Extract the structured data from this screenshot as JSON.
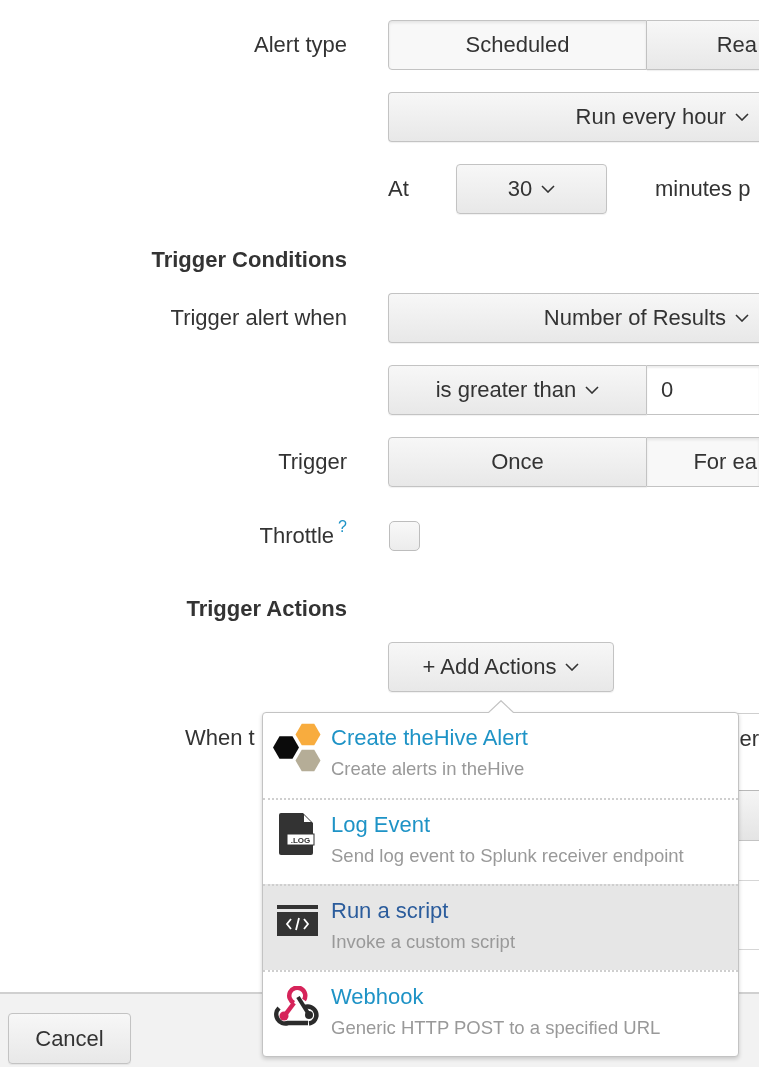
{
  "sections": [
    {
      "rows": [
        {
          "kind": "segmented",
          "label": "Alert type",
          "options": [
            {
              "label": "Scheduled",
              "selected": true
            },
            {
              "label": "Rea",
              "selected": false
            }
          ]
        },
        {
          "kind": "dropdown",
          "value": "Run every hour"
        },
        {
          "kind": "at",
          "prefix": "At",
          "value": "30",
          "suffix": "minutes p"
        }
      ]
    },
    {
      "heading": "Trigger Conditions",
      "rows": [
        {
          "kind": "dropdown",
          "label": "Trigger alert when",
          "value": "Number of Results"
        },
        {
          "kind": "compare",
          "operator": "is greater than",
          "value": "0"
        },
        {
          "kind": "segmented",
          "label": "Trigger",
          "options": [
            {
              "label": "Once",
              "selected": false
            },
            {
              "label": "For ea",
              "selected": true
            }
          ]
        },
        {
          "kind": "checkbox",
          "label": "Throttle",
          "help": "?",
          "checked": false
        }
      ]
    },
    {
      "heading": "Trigger Actions",
      "rows": [
        {
          "kind": "menu_button",
          "value": "+ Add Actions"
        },
        {
          "kind": "covered",
          "label": "When t",
          "value": "er"
        },
        {
          "kind": "covered_button"
        }
      ]
    }
  ],
  "actions_menu": {
    "items": [
      {
        "kind": "hive",
        "title": "Create theHive Alert",
        "description": "Create alerts in theHive",
        "selected": false
      },
      {
        "kind": "log",
        "icon_label": ".LOG",
        "title": "Log Event",
        "description": "Send log event to Splunk receiver endpoint",
        "selected": false
      },
      {
        "kind": "script",
        "title": "Run a script",
        "description": "Invoke a custom script",
        "selected": true
      },
      {
        "kind": "webhook",
        "title": "Webhook",
        "description": "Generic HTTP POST to a specified URL",
        "selected": false
      }
    ]
  },
  "footer": {
    "buttons": [
      "Cancel"
    ]
  }
}
